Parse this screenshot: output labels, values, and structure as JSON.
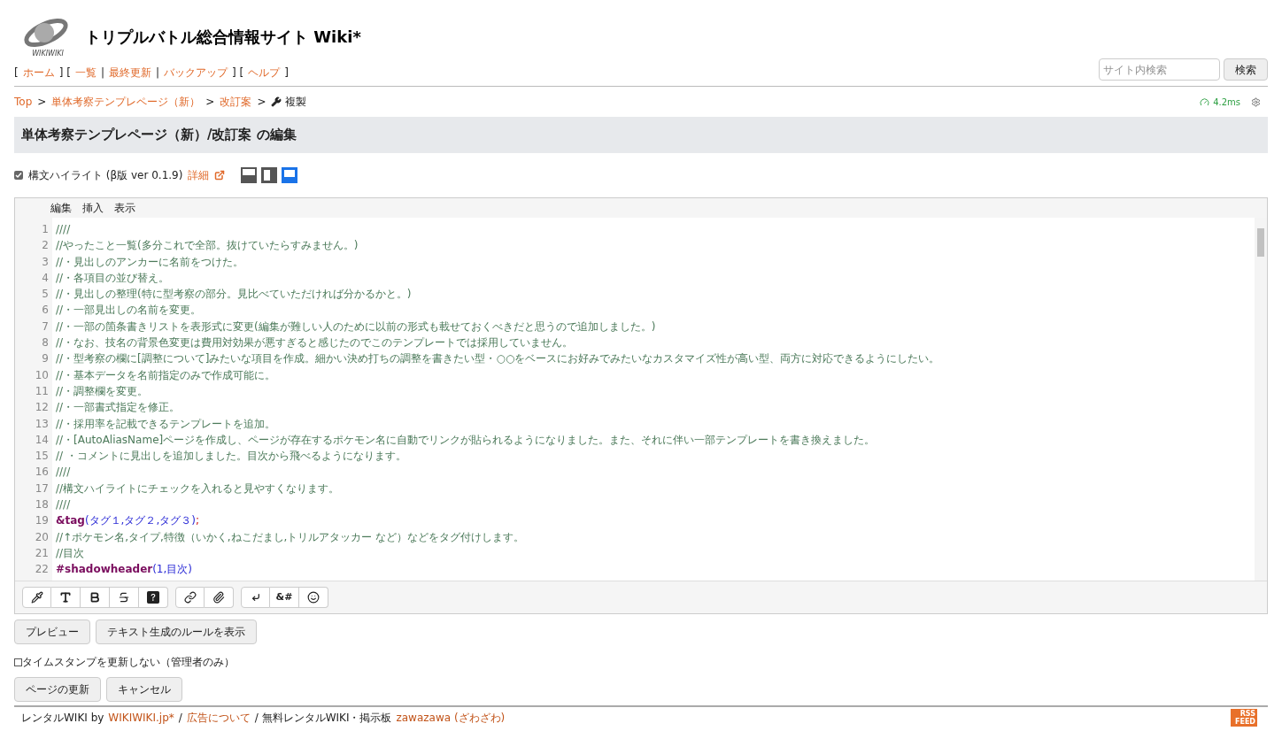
{
  "site": {
    "title": "トリプルバトル総合情報サイト Wiki*",
    "logo_text": "WIKIWIKI"
  },
  "nav": [
    {
      "kind": "bracket",
      "text": "["
    },
    {
      "kind": "link",
      "text": "ホーム"
    },
    {
      "kind": "bracket",
      "text": "] ["
    },
    {
      "kind": "link",
      "text": "一覧"
    },
    {
      "kind": "bracket",
      "text": "|"
    },
    {
      "kind": "link",
      "text": "最終更新"
    },
    {
      "kind": "bracket",
      "text": "|"
    },
    {
      "kind": "link",
      "text": "バックアップ"
    },
    {
      "kind": "bracket",
      "text": "] ["
    },
    {
      "kind": "link",
      "text": "ヘルプ"
    },
    {
      "kind": "bracket",
      "text": "]"
    }
  ],
  "search": {
    "placeholder": "サイト内検索",
    "button": "検索"
  },
  "breadcrumb": [
    {
      "kind": "link",
      "text": "Top"
    },
    {
      "kind": "sep",
      "text": ">"
    },
    {
      "kind": "link",
      "text": "単体考察テンプレページ（新）"
    },
    {
      "kind": "sep",
      "text": ">"
    },
    {
      "kind": "link",
      "text": "改訂案"
    },
    {
      "kind": "sep",
      "text": ">"
    },
    {
      "kind": "current",
      "text": "複製"
    }
  ],
  "timing": "4.2ms",
  "page_title": "単体考察テンプレページ（新）/改訂案 の編集",
  "highlight": {
    "checked": true,
    "label": "構文ハイライト (β版 ver 0.1.9)",
    "detail_link": "詳細",
    "layouts": [
      {
        "kind": "top",
        "selected": false
      },
      {
        "kind": "side",
        "selected": false
      },
      {
        "kind": "bottom",
        "selected": true
      }
    ]
  },
  "editor_menu": [
    "編集",
    "挿入",
    "表示"
  ],
  "code_lines": [
    {
      "number": "1",
      "segments": [
        {
          "kind": "comment",
          "text": "////"
        }
      ]
    },
    {
      "number": "2",
      "segments": [
        {
          "kind": "comment",
          "text": "//やったこと一覧(多分これで全部。抜けていたらすみません。)"
        }
      ]
    },
    {
      "number": "3",
      "segments": [
        {
          "kind": "comment",
          "text": "//・見出しのアンカーに名前をつけた。"
        }
      ]
    },
    {
      "number": "4",
      "segments": [
        {
          "kind": "comment",
          "text": "//・各項目の並び替え。"
        }
      ]
    },
    {
      "number": "5",
      "segments": [
        {
          "kind": "comment",
          "text": "//・見出しの整理(特に型考察の部分。見比べていただければ分かるかと。)"
        }
      ]
    },
    {
      "number": "6",
      "segments": [
        {
          "kind": "comment",
          "text": "//・一部見出しの名前を変更。"
        }
      ]
    },
    {
      "number": "7",
      "segments": [
        {
          "kind": "comment",
          "text": "//・一部の箇条書きリストを表形式に変更(編集が難しい人のために以前の形式も載せておくべきだと思うので追加しました。)"
        }
      ]
    },
    {
      "number": "8",
      "segments": [
        {
          "kind": "comment",
          "text": "//・なお、技名の背景色変更は費用対効果が悪すぎると感じたのでこのテンプレートでは採用していません。"
        }
      ]
    },
    {
      "number": "9",
      "segments": [
        {
          "kind": "comment",
          "text": "//・型考察の欄に[調整について]みたいな項目を作成。細かい決め打ちの調整を書きたい型・○○をベースにお好みでみたいなカスタマイズ性が高い型、両方に対応できるようにしたい。"
        }
      ]
    },
    {
      "number": "10",
      "segments": [
        {
          "kind": "comment",
          "text": "//・基本データを名前指定のみで作成可能に。"
        }
      ]
    },
    {
      "number": "11",
      "segments": [
        {
          "kind": "comment",
          "text": "//・調整欄を変更。"
        }
      ]
    },
    {
      "number": "12",
      "segments": [
        {
          "kind": "comment",
          "text": "//・一部書式指定を修正。"
        }
      ]
    },
    {
      "number": "13",
      "segments": [
        {
          "kind": "comment",
          "text": "//・採用率を記載できるテンプレートを追加。"
        }
      ]
    },
    {
      "number": "14",
      "segments": [
        {
          "kind": "comment",
          "text": "//・[AutoAliasName]ページを作成し、ページが存在するポケモン名に自動でリンクが貼られるようになりました。また、それに伴い一部テンプレートを書き換えました。"
        }
      ]
    },
    {
      "number": "15",
      "segments": [
        {
          "kind": "comment",
          "text": "// ・コメントに見出しを追加しました。目次から飛べるようになります。"
        }
      ]
    },
    {
      "number": "16",
      "segments": [
        {
          "kind": "comment",
          "text": "////"
        }
      ]
    },
    {
      "number": "17",
      "segments": [
        {
          "kind": "comment",
          "text": "//構文ハイライトにチェックを入れると見やすくなります。"
        }
      ]
    },
    {
      "number": "18",
      "segments": [
        {
          "kind": "comment",
          "text": "////"
        }
      ]
    },
    {
      "number": "19",
      "segments": [
        {
          "kind": "keyword",
          "text": "&tag"
        },
        {
          "kind": "arg",
          "text": "(タグ１,タグ２,タグ３)"
        },
        {
          "kind": "punct",
          "text": ";"
        }
      ]
    },
    {
      "number": "20",
      "segments": [
        {
          "kind": "comment",
          "text": "//↑ポケモン名,タイプ,特徴（いかく,ねこだまし,トリルアタッカー など）などをタグ付けします。"
        }
      ]
    },
    {
      "number": "21",
      "segments": [
        {
          "kind": "comment",
          "text": "//目次"
        }
      ]
    },
    {
      "number": "22",
      "segments": [
        {
          "kind": "keyword",
          "text": "#shadowheader"
        },
        {
          "kind": "arg",
          "text": "(1,目次)"
        }
      ]
    }
  ],
  "toolbar": [
    [
      {
        "kind": "pipette"
      },
      {
        "kind": "text-size"
      },
      {
        "kind": "bold"
      },
      {
        "kind": "strike"
      },
      {
        "kind": "help"
      }
    ],
    [
      {
        "kind": "link"
      },
      {
        "kind": "clip"
      }
    ],
    [
      {
        "kind": "return"
      },
      {
        "kind": "text",
        "text": "&#"
      },
      {
        "kind": "smile"
      }
    ]
  ],
  "action_buttons": [
    "プレビュー",
    "テキスト生成のルールを表示"
  ],
  "timestamp": {
    "checked": false,
    "label": "タイムスタンプを更新しない（管理者のみ）"
  },
  "submit_buttons": [
    "ページの更新",
    "キャンセル"
  ],
  "footer": [
    {
      "kind": "text",
      "text": "レンタルWIKI by"
    },
    {
      "kind": "link",
      "text": "WIKIWIKI.jp*"
    },
    {
      "kind": "text",
      "text": "/"
    },
    {
      "kind": "link",
      "text": "広告について"
    },
    {
      "kind": "text",
      "text": "/ 無料レンタルWIKI・掲示板"
    },
    {
      "kind": "link",
      "text": "zawazawa (ざわざわ)"
    }
  ],
  "rss": "RSS FEED"
}
